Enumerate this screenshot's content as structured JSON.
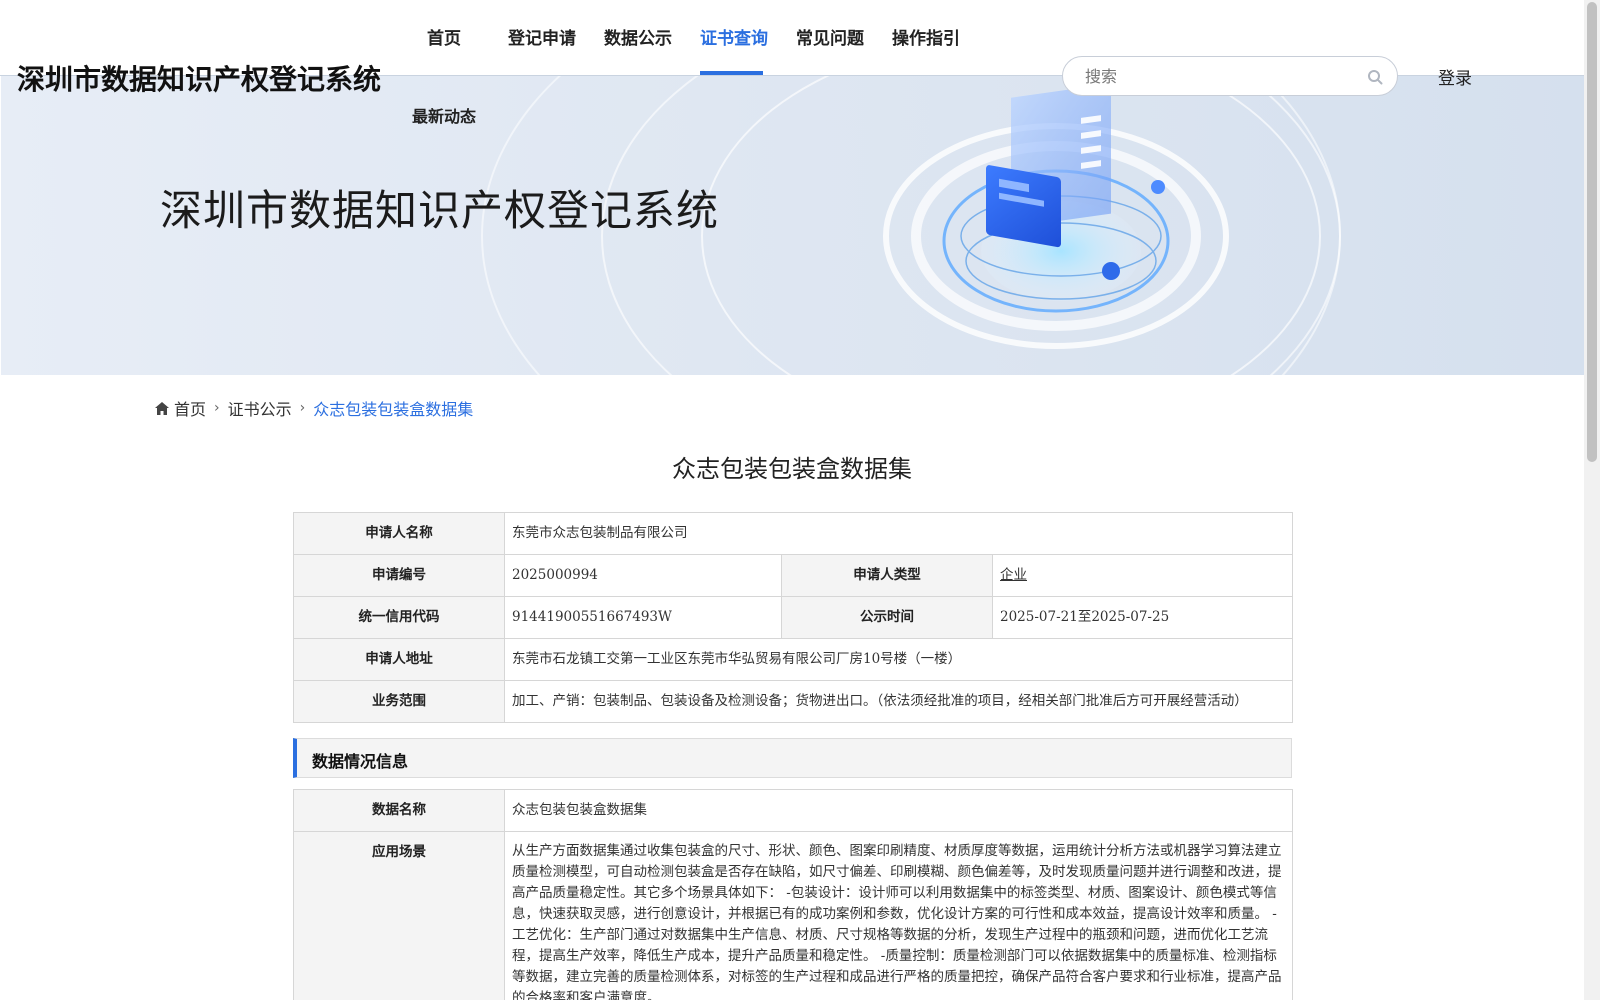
{
  "header": {
    "site_title": "深圳市数据知识产权登记系统",
    "nav": [
      {
        "label": "首页",
        "active": false
      },
      {
        "label": "登记申请",
        "active": false
      },
      {
        "label": "数据公示",
        "active": false
      },
      {
        "label": "证书查询",
        "active": true
      },
      {
        "label": "常见问题",
        "active": false
      },
      {
        "label": "操作指引",
        "active": false
      }
    ],
    "nav_second_row": "最新动态",
    "search_placeholder": "搜索",
    "login_label": "登录"
  },
  "banner": {
    "title": "深圳市数据知识产权登记系统"
  },
  "breadcrumb": {
    "home": "首页",
    "parent": "证书公示",
    "current": "众志包装包装盒数据集"
  },
  "page_title": "众志包装包装盒数据集",
  "applicant": {
    "name_label": "申请人名称",
    "name_value": "东莞市众志包装制品有限公司",
    "number_label": "申请编号",
    "number_value": "2025000994",
    "type_label": "申请人类型",
    "type_value": "企业",
    "credit_label": "统一信用代码",
    "credit_value": "91441900551667493W",
    "time_label": "公示时间",
    "time_value": "2025-07-21至2025-07-25",
    "address_label": "申请人地址",
    "address_value": "东莞市石龙镇工交第一工业区东莞市华弘贸易有限公司厂房10号楼（一楼）",
    "scope_label": "业务范围",
    "scope_value": "加工、产销：包装制品、包装设备及检测设备；货物进出口。（依法须经批准的项目，经相关部门批准后方可开展经营活动）"
  },
  "data_section": {
    "heading": "数据情况信息",
    "data_name_label": "数据名称",
    "data_name_value": "众志包装包装盒数据集",
    "scenario_label": "应用场景",
    "scenario_value": "从生产方面数据集通过收集包装盒的尺寸、形状、颜色、图案印刷精度、材质厚度等数据，运用统计分析方法或机器学习算法建立质量检测模型，可自动检测包装盒是否存在缺陷，如尺寸偏差、印刷模糊、颜色偏差等，及时发现质量问题并进行调整和改进，提高产品质量稳定性。其它多个场景具体如下： -包装设计：设计师可以利用数据集中的标签类型、材质、图案设计、颜色模式等信息，快速获取灵感，进行创意设计，并根据已有的成功案例和参数，优化设计方案的可行性和成本效益，提高设计效率和质量。 -工艺优化：生产部门通过对数据集中生产信息、材质、尺寸规格等数据的分析，发现生产过程中的瓶颈和问题，进而优化工艺流程，提高生产效率，降低生产成本，提升产品质量和稳定性。 -质量控制：质量检测部门可以依据数据集中的质量标准、检测指标等数据，建立完善的质量检测体系，对标签的生产过程和成品进行严格的质量把控，确保产品符合客户要求和行业标准，提高产品的合格率和客户满意度。"
  },
  "colors": {
    "accent": "#2b6fe0",
    "label_bg": "#f4f4f4",
    "border": "#d6d6d6"
  }
}
